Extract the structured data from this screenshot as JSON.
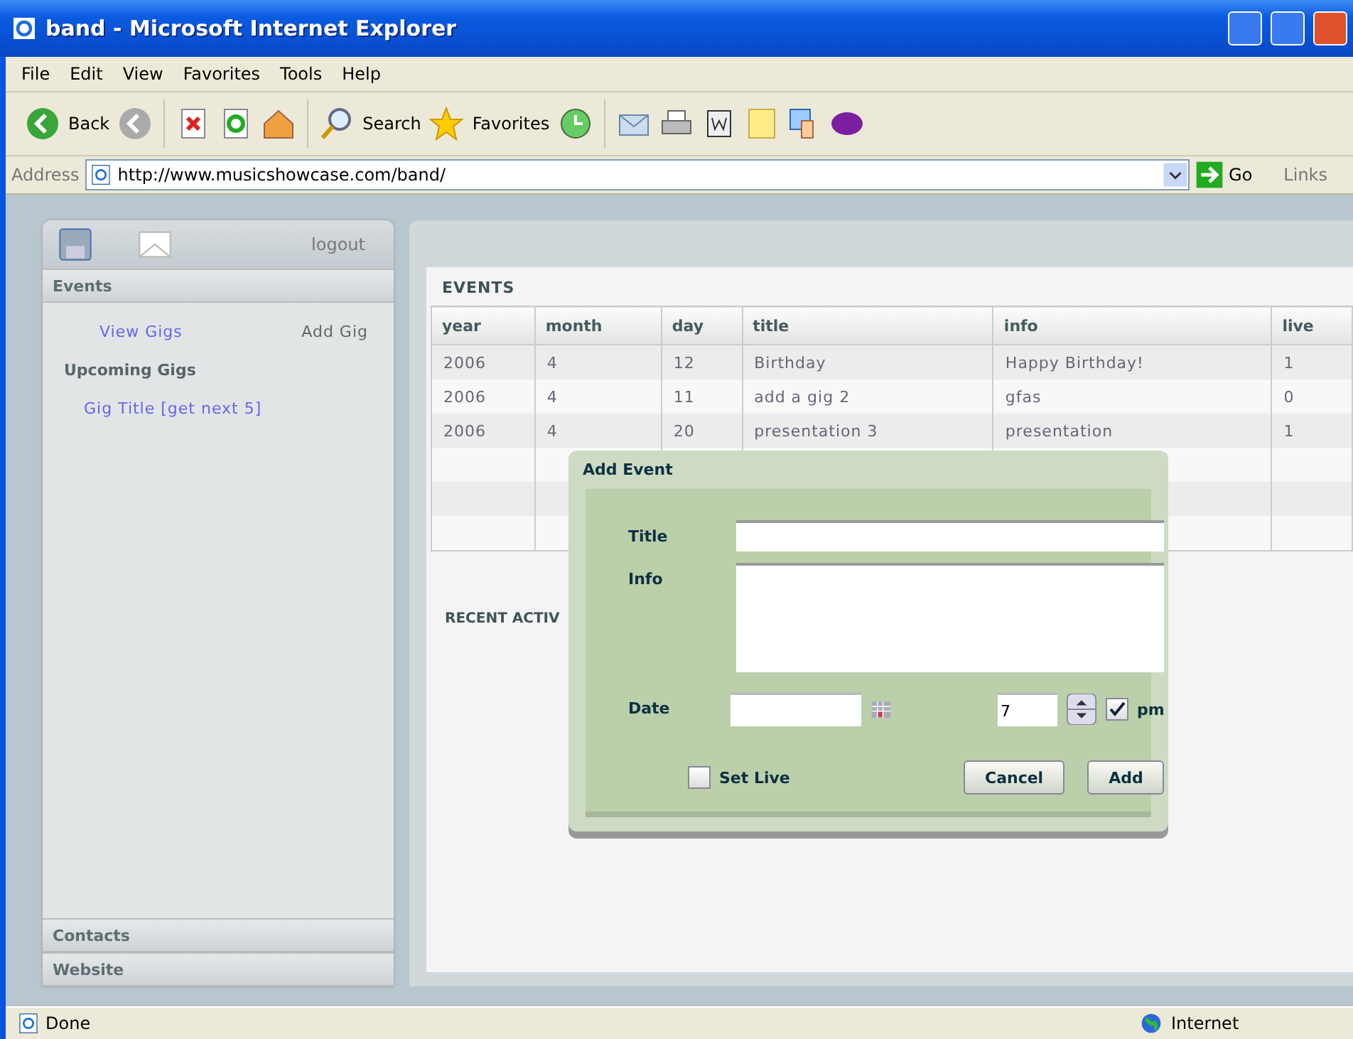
{
  "window": {
    "title": "band - Microsoft Internet Explorer"
  },
  "menu": [
    "File",
    "Edit",
    "View",
    "Favorites",
    "Tools",
    "Help"
  ],
  "toolbar": {
    "back": "Back",
    "search": "Search",
    "favorites": "Favorites"
  },
  "address": {
    "label": "Address",
    "url": "http://www.musicshowcase.com/band/",
    "go": "Go",
    "links": "Links"
  },
  "sidebar": {
    "logout": "logout",
    "sections": [
      {
        "title": "Events",
        "expanded": true,
        "links": [
          {
            "label": "View Gigs",
            "selected": false
          },
          {
            "label": "Add Gig",
            "selected": true
          }
        ],
        "subheading": "Upcoming Gigs",
        "item": "Gig Title [get next 5]"
      },
      {
        "title": "Contacts",
        "expanded": false
      },
      {
        "title": "Website",
        "expanded": false
      }
    ]
  },
  "events": {
    "heading": "EVENTS",
    "columns": [
      "year",
      "month",
      "day",
      "title",
      "info",
      "live"
    ],
    "rows": [
      [
        "2006",
        "4",
        "12",
        "Birthday",
        "Happy Birthday!",
        "1"
      ],
      [
        "2006",
        "4",
        "11",
        "add a gig 2",
        "gfas",
        "0"
      ],
      [
        "2006",
        "4",
        "20",
        "presentation 3",
        "presentation",
        "1"
      ]
    ]
  },
  "recent": {
    "heading": "RECENT ACTIV"
  },
  "dialog": {
    "title": "Add Event",
    "title_label": "Title",
    "info_label": "Info",
    "date_label": "Date",
    "hour": "7",
    "pm": {
      "label": "pm",
      "checked": true
    },
    "set_live": {
      "label": "Set Live",
      "checked": false
    },
    "buttons": [
      "Cancel",
      "Add"
    ]
  },
  "status_bar": {
    "text": "Done",
    "zone": "Internet"
  }
}
